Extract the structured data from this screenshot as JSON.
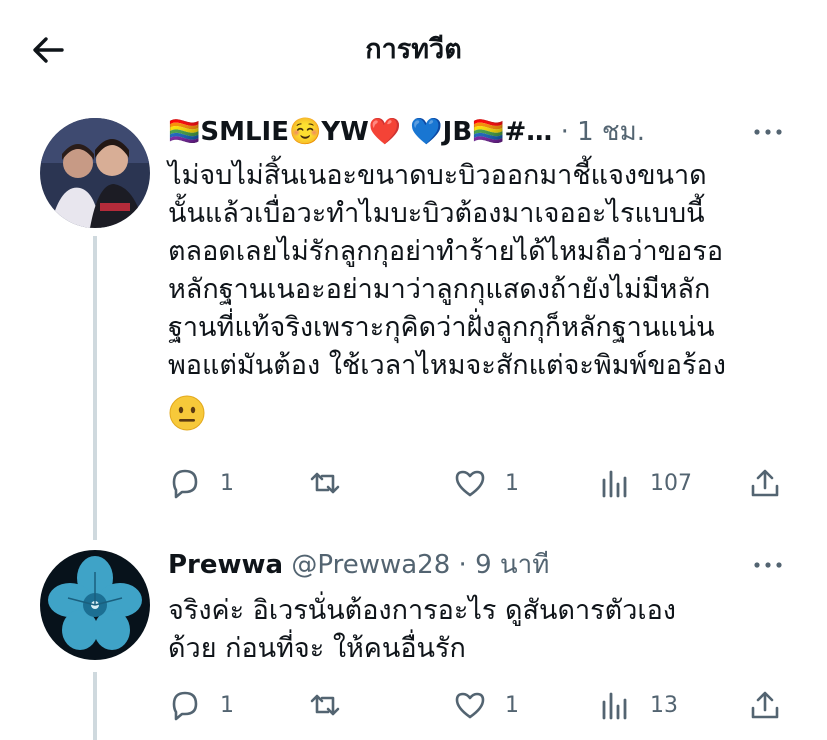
{
  "header": {
    "title": "การทวีต",
    "back_icon": "arrow-left-icon"
  },
  "tweets": [
    {
      "display_name": "🏳️‍🌈SMLIE☺️YW❤️ 💙JB🏳️‍🌈#…",
      "handle": "",
      "separator": "·",
      "time": "1 ชม.",
      "text_lines": [
        "ไม่จบไม่สิ้นเนอะขนาดบะบิวออกมาชี้แจงขนาด",
        "นั้นแล้วเบื่อวะทำไมบะบิวต้องมาเจออะไรแบบนี้",
        "ตลอดเลยไม่รักลูกกุอย่าทำร้ายได้ไหมถือว่าขอรอ",
        "หลักฐานเนอะอย่ามาว่าลูกกุแสดงถ้ายังไม่มีหลัก",
        "ฐานที่แท้จริงเพราะกุคิดว่าฝั่งลูกกุก็หลักฐานแน่น",
        "พอแต่มันต้อง ใช้เวลาไหมจะสักแต่จะพิมพ์ขอร้อง"
      ],
      "emoji": "😐",
      "replies": "1",
      "retweets": "",
      "likes": "1",
      "views": "107"
    },
    {
      "display_name": "Prewwa",
      "handle": "@Prewwa28",
      "separator": "·",
      "time": "9 นาที",
      "text_lines": [
        "จริงค่ะ อิเวรนั่นต้องการอะไร ดูสันดารตัวเอง",
        "ด้วย ก่อนที่จะ ให้คนอื่นรัก"
      ],
      "replies": "1",
      "retweets": "",
      "likes": "1",
      "views": "13"
    }
  ],
  "colors": {
    "text": "#0f1419",
    "muted": "#536471",
    "line": "#cfd9de"
  }
}
